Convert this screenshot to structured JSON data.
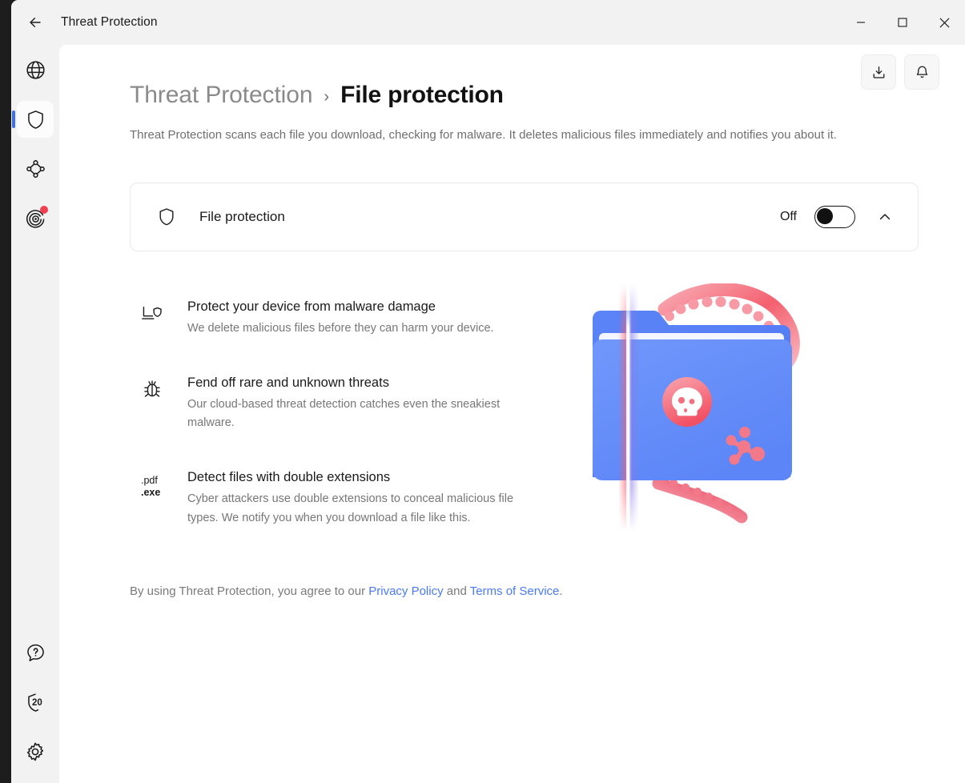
{
  "window": {
    "title": "Threat Protection",
    "back_icon": "arrow-left-icon",
    "controls": {
      "minimize": "minimize-icon",
      "maximize": "maximize-icon",
      "close": "close-icon"
    }
  },
  "sidebar": {
    "top_items": [
      {
        "name": "globe-icon",
        "label": "VPN",
        "active": false,
        "badge": false
      },
      {
        "name": "shield-icon",
        "label": "Threat Protection",
        "active": true,
        "badge": false
      },
      {
        "name": "mesh-network-icon",
        "label": "Meshnet",
        "active": false,
        "badge": false
      },
      {
        "name": "dark-web-monitor-icon",
        "label": "Dark Web Monitor",
        "active": false,
        "badge": true
      }
    ],
    "bottom_items": [
      {
        "name": "help-icon",
        "label": "Help",
        "count": ""
      },
      {
        "name": "shield-count-icon",
        "label": "Protection score",
        "count": "20"
      },
      {
        "name": "gear-icon",
        "label": "Settings",
        "count": ""
      }
    ]
  },
  "content_actions": [
    {
      "name": "download-icon",
      "label": "Downloads"
    },
    {
      "name": "bell-icon",
      "label": "Notifications"
    }
  ],
  "page": {
    "breadcrumb_parent": "Threat Protection",
    "breadcrumb_separator": "›",
    "breadcrumb_current": "File protection",
    "description": "Threat Protection scans each file you download, checking for malware. It deletes malicious files immediately and notifies you about it."
  },
  "toggle_card": {
    "icon": "shield-icon",
    "label": "File protection",
    "state_label": "Off",
    "enabled": false,
    "collapse_icon": "chevron-up-icon"
  },
  "features": [
    {
      "icon": "device-shield-icon",
      "title": "Protect your device from malware damage",
      "description": "We delete malicious files before they can harm your device."
    },
    {
      "icon": "bug-icon",
      "title": "Fend off rare and unknown threats",
      "description": "Our cloud-based threat detection catches even the sneakiest malware."
    },
    {
      "icon": "file-extension-icon",
      "icon_line1": ".pdf",
      "icon_line2": ".exe",
      "title": "Detect files with double extensions",
      "description": "Cyber attackers use double extensions to conceal malicious file types. We notify you when you download a file like this."
    }
  ],
  "illustration": {
    "name": "infected-folder-illustration",
    "folder_color": "#5B84F7",
    "folder_color_light": "#7098FB",
    "threat_color": "#F4606F",
    "threat_color_light": "#F9A7B0",
    "skull_badge": "skull-icon",
    "molecule": "molecule-icon",
    "tentacles": 2,
    "scan_beam": true
  },
  "legal": {
    "prefix": "By using Threat Protection, you agree to our ",
    "link1": "Privacy Policy",
    "middle": " and ",
    "link2": "Terms of Service",
    "suffix": "."
  },
  "colors": {
    "accent_blue": "#3c6ef0",
    "link_blue": "#4a7afb",
    "badge_red": "#ef4152",
    "window_bg": "#f2f2f2",
    "content_bg": "#ffffff"
  }
}
